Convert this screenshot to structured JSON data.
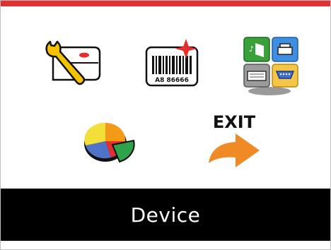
{
  "screen": {
    "title": "Device",
    "accent_color": "#e32f2f"
  },
  "menu": {
    "items": [
      {
        "name": "settings",
        "icon": "wrench-printer-icon"
      },
      {
        "name": "label",
        "icon": "barcode-label-icon",
        "barcode_text": "A8 86666"
      },
      {
        "name": "interface",
        "icon": "interface-ports-icon"
      },
      {
        "name": "statistics",
        "icon": "pie-chart-icon"
      },
      {
        "name": "exit",
        "icon": "exit-arrow-icon",
        "label": "EXIT"
      }
    ]
  }
}
